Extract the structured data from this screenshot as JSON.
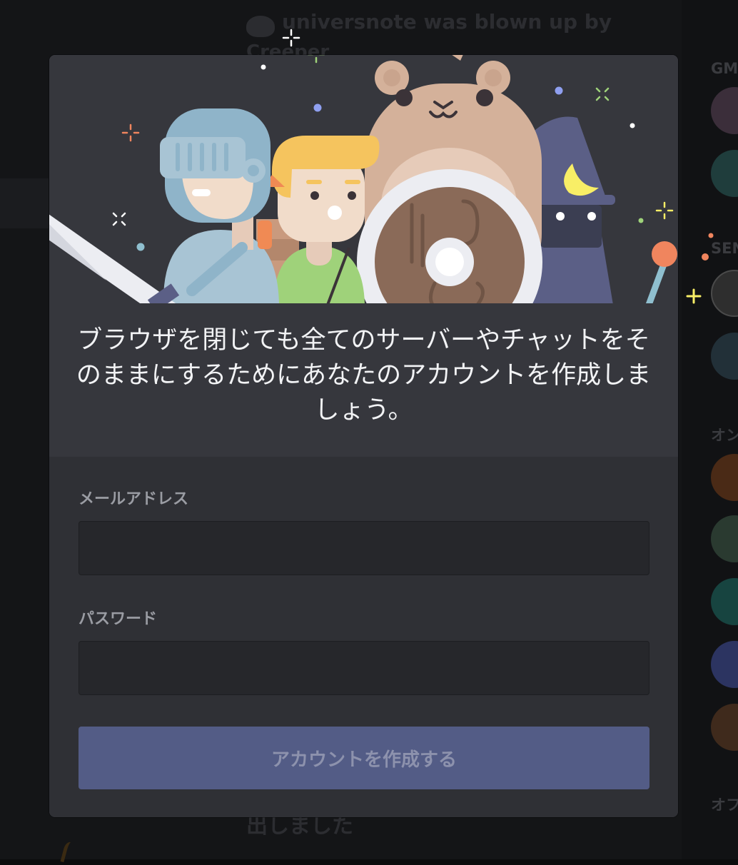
{
  "background": {
    "message_line1": "universnote was blown up by",
    "message_line2": "Creeper",
    "message_line3": "出しました",
    "member_headings": [
      "GM",
      "SEN",
      "オン",
      "オフ"
    ]
  },
  "modal": {
    "headline": "ブラウザを閉じても全てのサーバーやチャットをそのままにするためにあなたのアカウントを作成しましょう。",
    "email": {
      "label": "メールアドレス",
      "value": ""
    },
    "password": {
      "label": "パスワード",
      "value": ""
    },
    "submit_label": "アカウントを作成する",
    "submit_disabled": true
  },
  "colors": {
    "accent_button": "#535c86",
    "modal_bg": "#36373d",
    "form_bg": "#2f3035"
  },
  "icons": [
    "knight-icon",
    "hero-icon",
    "bear-icon",
    "wizard-icon",
    "sword-icon",
    "shield-icon",
    "sparkle-icon"
  ]
}
